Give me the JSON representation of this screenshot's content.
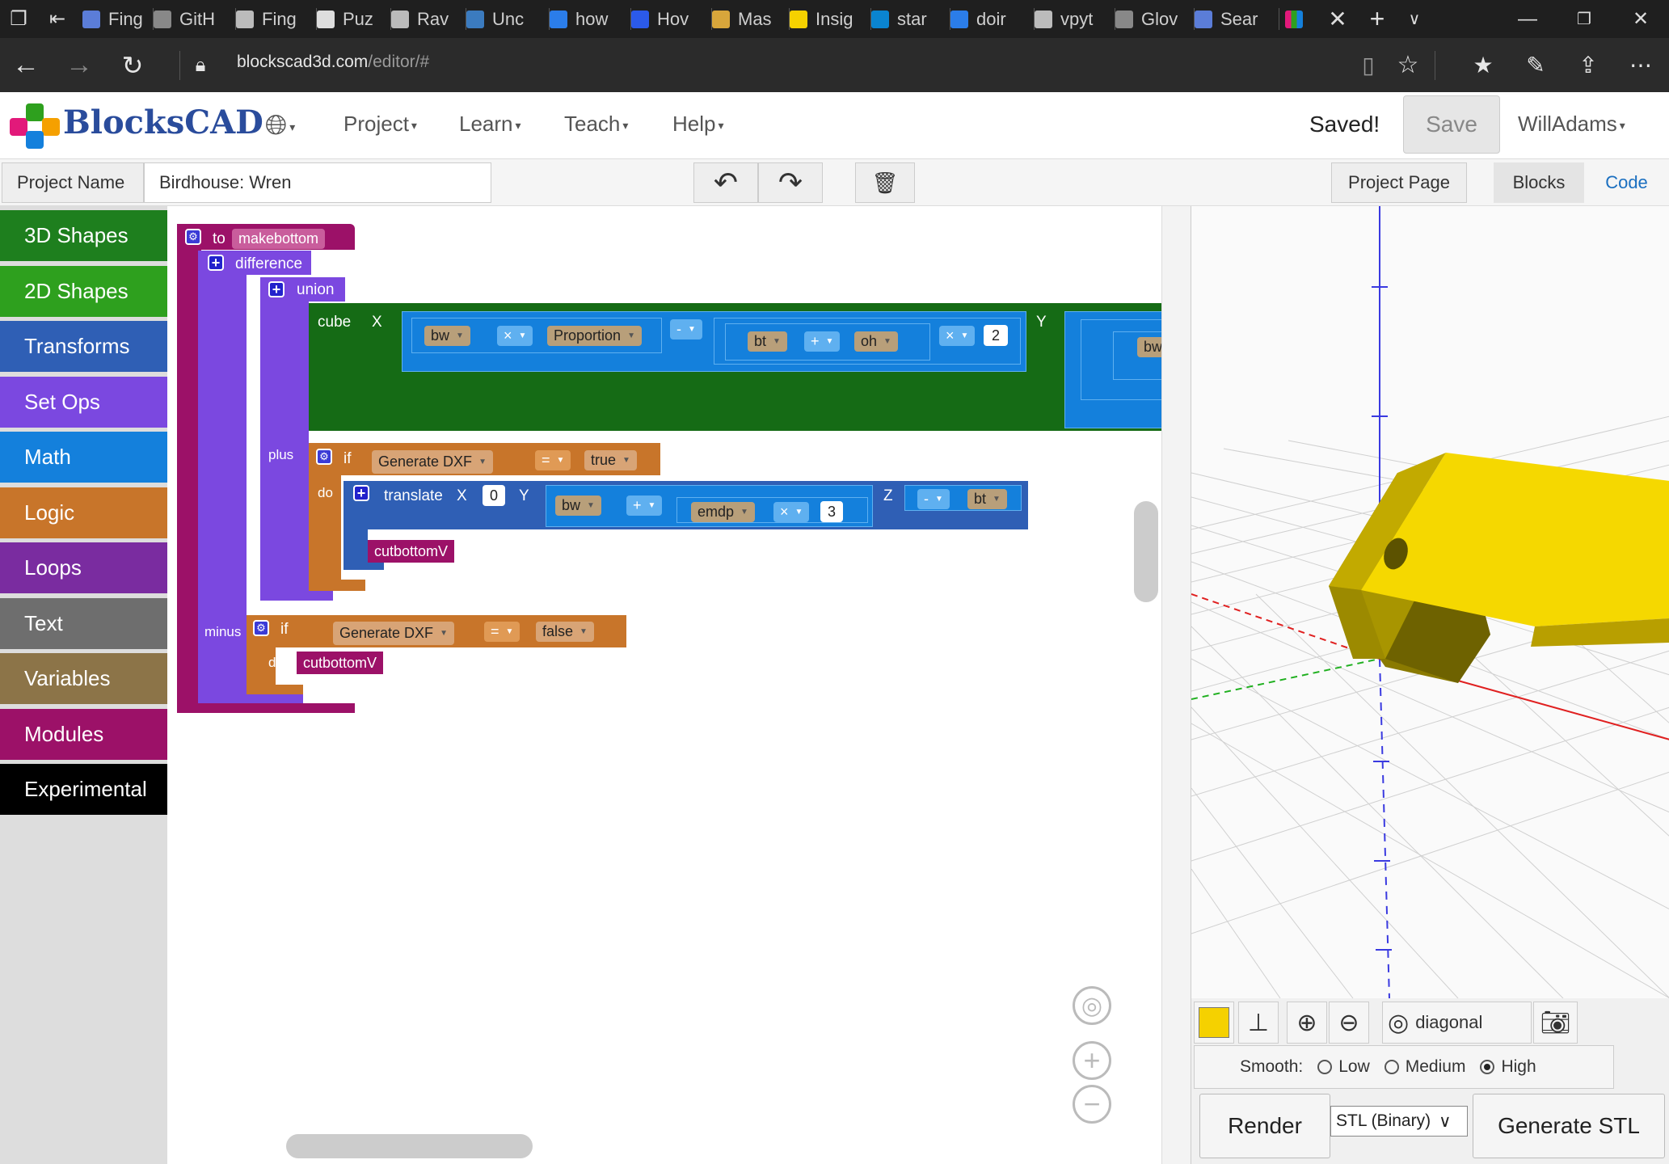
{
  "browser": {
    "tabs": [
      {
        "label": "Fing",
        "color": "#5b7dd8"
      },
      {
        "label": "GitH",
        "color": "#888888"
      },
      {
        "label": "Fing",
        "color": "#bbbbbb"
      },
      {
        "label": "Puz",
        "color": "#dddddd"
      },
      {
        "label": "Rav",
        "color": "#bbbbbb"
      },
      {
        "label": "Unc",
        "color": "#3b7bbf"
      },
      {
        "label": "how",
        "color": "#2b7de9"
      },
      {
        "label": "Hov",
        "color": "#2b5ae9"
      },
      {
        "label": "Mas",
        "color": "#d8a63b"
      },
      {
        "label": "Insig",
        "color": "#f5d100"
      },
      {
        "label": "star",
        "color": "#0a84d0"
      },
      {
        "label": "doir",
        "color": "#2b7de9"
      },
      {
        "label": "vpyt",
        "color": "#bbbbbb"
      },
      {
        "label": "Glov",
        "color": "#888888"
      },
      {
        "label": "Sear",
        "color": "#5b7dd8"
      }
    ],
    "url_host": "blockscad3d.com",
    "url_path": "/editor/#"
  },
  "app": {
    "logo": "BlocksCAD",
    "menu": [
      "Project",
      "Learn",
      "Teach",
      "Help"
    ],
    "status": "Saved!",
    "save_label": "Save",
    "user": "WillAdams"
  },
  "project": {
    "name_label": "Project Name",
    "name_value": "Birdhouse: Wren",
    "project_page": "Project Page",
    "blocks_tab": "Blocks",
    "code_tab": "Code"
  },
  "categories": [
    {
      "label": "3D Shapes",
      "color": "#1e7f1e"
    },
    {
      "label": "2D Shapes",
      "color": "#2ea01e"
    },
    {
      "label": "Transforms",
      "color": "#2f5fb5"
    },
    {
      "label": "Set Ops",
      "color": "#7b48e0"
    },
    {
      "label": "Math",
      "color": "#1480dc"
    },
    {
      "label": "Logic",
      "color": "#c8752a"
    },
    {
      "label": "Loops",
      "color": "#7a2ca0"
    },
    {
      "label": "Text",
      "color": "#6e6e6e"
    },
    {
      "label": "Variables",
      "color": "#8c7448"
    },
    {
      "label": "Modules",
      "color": "#9c1168"
    },
    {
      "label": "Experimental",
      "color": "#000000"
    }
  ],
  "blocks": {
    "to": "to",
    "module_name": "makebottom",
    "difference": "difference",
    "union": "union",
    "cube": "cube",
    "x": "X",
    "y": "Y",
    "z": "Z",
    "bw": "bw",
    "times": "×",
    "plus_op": "+",
    "minus_op": "-",
    "eq": "=",
    "proportion": "Proportion",
    "bt": "bt",
    "oh": "oh",
    "two": "2",
    "bw_trunc": "bw",
    "plus": "plus",
    "minus": "minus",
    "if": "if",
    "do": "do",
    "generate_dxf": "Generate DXF",
    "true": "true",
    "false": "false",
    "translate": "translate",
    "zero": "0",
    "emdp": "emdp",
    "three": "3",
    "cutbottomV": "cutbottomV"
  },
  "viewer": {
    "view_select": "diagonal",
    "smooth_label": "Smooth:",
    "smooth_options": [
      "Low",
      "Medium",
      "High"
    ],
    "smooth_selected": "High",
    "render": "Render",
    "format": "STL (Binary)",
    "generate": "Generate STL",
    "color_swatch": "#f5d100"
  }
}
